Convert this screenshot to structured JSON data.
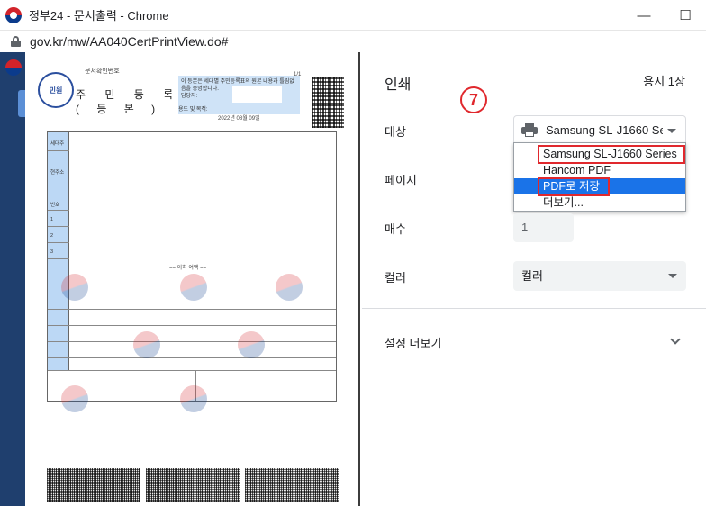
{
  "window": {
    "title": "정부24 - 문서출력 - Chrome",
    "minimize": "—",
    "maximize": "☐",
    "url": "gov.kr/mw/AA040CertPrintView.do#"
  },
  "document": {
    "doc_no_label": "문서확인번호 :",
    "page_frac": "1/1",
    "seal_main": "민원",
    "title": "주 민 등 록 표",
    "subtitle": "( 등    본 )",
    "cert_text": "이 등본은 세대별 주민등록표의 원본 내용과 틀림없음을 증명합니다.",
    "cert_line2": "담당자:",
    "issuer": "용도 및 목적:",
    "date": "2022년 08월 09일",
    "row_labels": [
      "세대주",
      "현주소",
      "번호",
      "1",
      "2",
      "3"
    ],
    "end_mark": "== 이하 여백 =="
  },
  "panel": {
    "title": "인쇄",
    "sheet_count": "용지 1장",
    "step_marker": "7",
    "destination_label": "대상",
    "destination_value": "Samsung SL-J1660 Se",
    "destination_options": [
      "Samsung SL-J1660 Series",
      "Hancom PDF",
      "PDF로 저장",
      "더보기..."
    ],
    "pages_label": "페이지",
    "copies_label": "매수",
    "copies_value": "1",
    "color_label": "컬러",
    "color_value": "컬러",
    "more_settings": "설정 더보기"
  },
  "colors": {
    "accent": "#1a73e8",
    "highlight": "#e0282d"
  }
}
